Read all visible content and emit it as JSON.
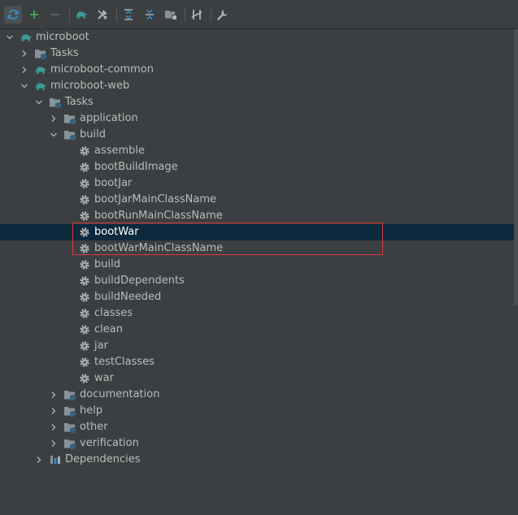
{
  "toolbar": {
    "buttons": [
      {
        "name": "reload-all-gradle-projects-button",
        "icon": "reload-icon",
        "active": true
      },
      {
        "name": "add-project-button",
        "icon": "plus-icon"
      },
      {
        "name": "remove-project-button",
        "icon": "minus-icon"
      },
      {
        "sep": true
      },
      {
        "name": "execute-gradle-task-button",
        "icon": "elephant-icon"
      },
      {
        "name": "toggle-offline-mode-button",
        "icon": "offline-tools-icon"
      },
      {
        "sep": true
      },
      {
        "name": "expand-all-button",
        "icon": "expand-all-icon"
      },
      {
        "name": "collapse-all-button",
        "icon": "collapse-all-icon"
      },
      {
        "name": "analyze-dependencies-button",
        "icon": "folder-tree-icon"
      },
      {
        "sep": true
      },
      {
        "name": "toggle-show-tasks-button",
        "icon": "skip-tests-icon"
      },
      {
        "sep": true
      },
      {
        "name": "build-tool-settings-button",
        "icon": "wrench-icon"
      }
    ]
  },
  "tree": [
    {
      "label": "microboot",
      "depth": 0,
      "arrow": "down",
      "icon": "elephant-icon"
    },
    {
      "label": "Tasks",
      "depth": 1,
      "arrow": "right",
      "icon": "tasks-folder-icon"
    },
    {
      "label": "microboot-common",
      "depth": 1,
      "arrow": "right",
      "icon": "elephant-icon"
    },
    {
      "label": "microboot-web",
      "depth": 1,
      "arrow": "down",
      "icon": "elephant-icon"
    },
    {
      "label": "Tasks",
      "depth": 2,
      "arrow": "down",
      "icon": "tasks-folder-icon"
    },
    {
      "label": "application",
      "depth": 3,
      "arrow": "right",
      "icon": "tasks-folder-icon"
    },
    {
      "label": "build",
      "depth": 3,
      "arrow": "down",
      "icon": "tasks-folder-icon"
    },
    {
      "label": "assemble",
      "depth": 4,
      "icon": "gear-icon"
    },
    {
      "label": "bootBuildImage",
      "depth": 4,
      "icon": "gear-icon"
    },
    {
      "label": "bootJar",
      "depth": 4,
      "icon": "gear-icon"
    },
    {
      "label": "bootJarMainClassName",
      "depth": 4,
      "icon": "gear-icon"
    },
    {
      "label": "bootRunMainClassName",
      "depth": 4,
      "icon": "gear-icon"
    },
    {
      "label": "bootWar",
      "depth": 4,
      "icon": "gear-icon",
      "selected": true
    },
    {
      "label": "bootWarMainClassName",
      "depth": 4,
      "icon": "gear-icon"
    },
    {
      "label": "build",
      "depth": 4,
      "icon": "gear-icon"
    },
    {
      "label": "buildDependents",
      "depth": 4,
      "icon": "gear-icon"
    },
    {
      "label": "buildNeeded",
      "depth": 4,
      "icon": "gear-icon"
    },
    {
      "label": "classes",
      "depth": 4,
      "icon": "gear-icon"
    },
    {
      "label": "clean",
      "depth": 4,
      "icon": "gear-icon"
    },
    {
      "label": "jar",
      "depth": 4,
      "icon": "gear-icon"
    },
    {
      "label": "testClasses",
      "depth": 4,
      "icon": "gear-icon"
    },
    {
      "label": "war",
      "depth": 4,
      "icon": "gear-icon"
    },
    {
      "label": "documentation",
      "depth": 3,
      "arrow": "right",
      "icon": "tasks-folder-icon"
    },
    {
      "label": "help",
      "depth": 3,
      "arrow": "right",
      "icon": "tasks-folder-icon"
    },
    {
      "label": "other",
      "depth": 3,
      "arrow": "right",
      "icon": "tasks-folder-icon"
    },
    {
      "label": "verification",
      "depth": 3,
      "arrow": "right",
      "icon": "tasks-folder-icon"
    },
    {
      "label": "Dependencies",
      "depth": 2,
      "arrow": "right",
      "icon": "dependencies-icon"
    }
  ],
  "colors": {
    "background": "#3c3f41",
    "selection": "#0d293e",
    "text": "#bbbbbb",
    "gradle_elephant": "#3d9b96",
    "folder": "#87939a",
    "gear": "#afb1b3",
    "highlight_box": "#d83b3b"
  }
}
